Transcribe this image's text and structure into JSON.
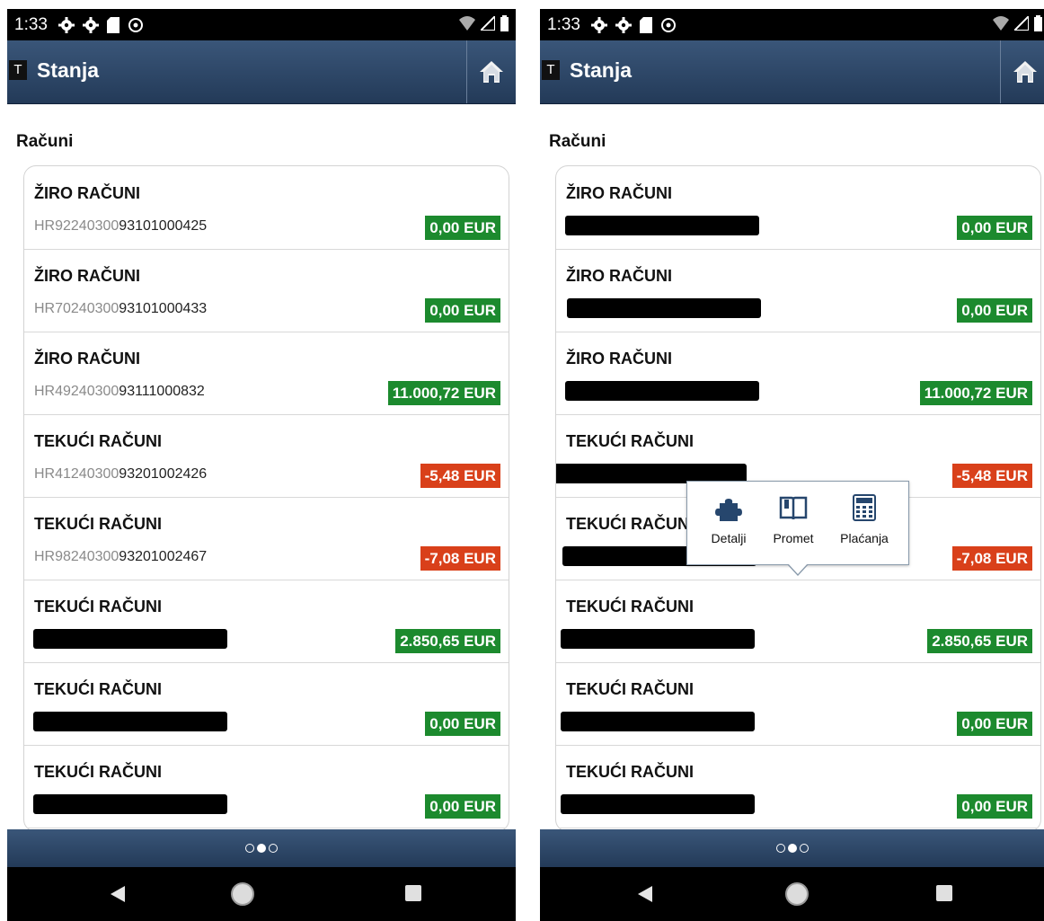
{
  "status_bar": {
    "time": "1:33"
  },
  "header": {
    "title": "Stanja",
    "app_icon_letter": "T"
  },
  "section": {
    "title": "Računi"
  },
  "left_accounts": [
    {
      "type": "ŽIRO RAČUNI",
      "iban_prefix": "HR92240300",
      "iban_suffix": "93101000425",
      "amount": "0,00 EUR",
      "status": "positive"
    },
    {
      "type": "ŽIRO RAČUNI",
      "iban_prefix": "HR70240300",
      "iban_suffix": "93101000433",
      "amount": "0,00 EUR",
      "status": "positive"
    },
    {
      "type": "ŽIRO RAČUNI",
      "iban_prefix": "HR49240300",
      "iban_suffix": "93111000832",
      "amount": "11.000,72 EUR",
      "status": "positive"
    },
    {
      "type": "TEKUĆI RAČUNI",
      "iban_prefix": "HR41240300",
      "iban_suffix": "93201002426",
      "amount": "-5,48 EUR",
      "status": "negative"
    },
    {
      "type": "TEKUĆI RAČUNI",
      "iban_prefix": "HR98240300",
      "iban_suffix": "93201002467",
      "amount": "-7,08 EUR",
      "status": "negative"
    },
    {
      "type": "TEKUĆI RAČUNI",
      "iban_prefix": "",
      "iban_suffix": "",
      "amount": "2.850,65 EUR",
      "status": "positive",
      "redacted": true
    },
    {
      "type": "TEKUĆI RAČUNI",
      "iban_prefix": "",
      "iban_suffix": "",
      "amount": "0,00 EUR",
      "status": "positive",
      "redacted": true
    },
    {
      "type": "TEKUĆI RAČUNI",
      "iban_prefix": "",
      "iban_suffix": "",
      "amount": "0,00 EUR",
      "status": "positive",
      "redacted": true
    }
  ],
  "right_accounts": [
    {
      "type": "ŽIRO RAČUNI",
      "amount": "0,00 EUR",
      "status": "positive"
    },
    {
      "type": "ŽIRO RAČUNI",
      "amount": "0,00 EUR",
      "status": "positive"
    },
    {
      "type": "ŽIRO RAČUNI",
      "amount": "11.000,72 EUR",
      "status": "positive"
    },
    {
      "type": "TEKUĆI RAČUNI",
      "amount": "-5,48 EUR",
      "status": "negative"
    },
    {
      "type": "TEKUĆI RAČUNI",
      "amount": "-7,08 EUR",
      "status": "negative"
    },
    {
      "type": "TEKUĆI RAČUNI",
      "amount": "2.850,65 EUR",
      "status": "positive"
    },
    {
      "type": "TEKUĆI RAČUNI",
      "amount": "0,00 EUR",
      "status": "positive"
    },
    {
      "type": "TEKUĆI RAČUNI",
      "amount": "0,00 EUR",
      "status": "positive"
    }
  ],
  "popup": {
    "items": [
      {
        "label": "Detalji",
        "icon": "puzzle-icon"
      },
      {
        "label": "Promet",
        "icon": "book-icon"
      },
      {
        "label": "Plaćanja",
        "icon": "calculator-icon"
      }
    ]
  },
  "pager": {
    "count": 3,
    "active": 1
  },
  "colors": {
    "header": "#2f4a6d",
    "positive": "#1c8a2e",
    "negative": "#d9401a"
  }
}
